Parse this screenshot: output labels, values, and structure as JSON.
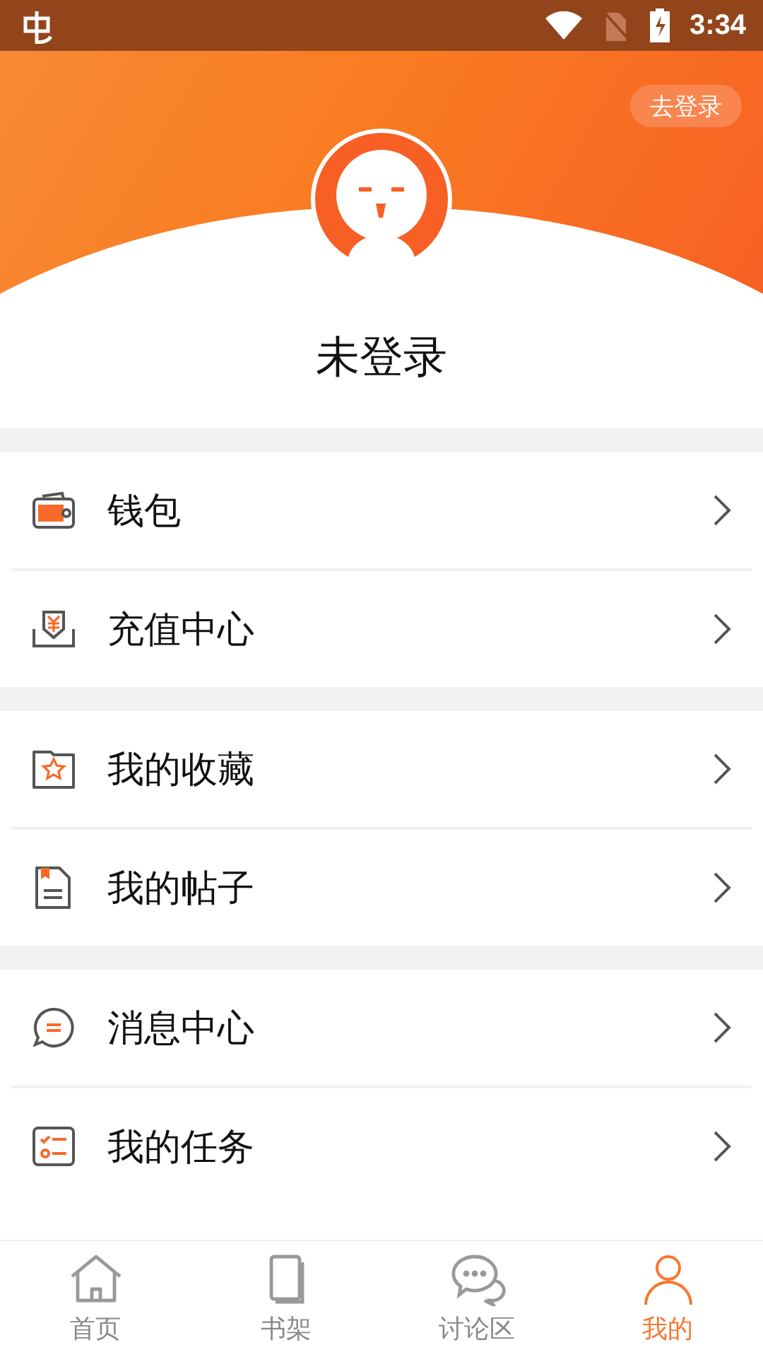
{
  "status_bar": {
    "time": "3:34"
  },
  "header": {
    "login_button": "去登录",
    "user_name": "未登录"
  },
  "groups": [
    {
      "items": [
        {
          "label": "钱包",
          "kind": "wallet"
        },
        {
          "label": "充值中心",
          "kind": "recharge"
        }
      ]
    },
    {
      "items": [
        {
          "label": "我的收藏",
          "kind": "favorites"
        },
        {
          "label": "我的帖子",
          "kind": "posts"
        }
      ]
    },
    {
      "items": [
        {
          "label": "消息中心",
          "kind": "messages"
        },
        {
          "label": "我的任务",
          "kind": "tasks"
        }
      ]
    }
  ],
  "tab_bar": [
    {
      "label": "首页",
      "kind": "home",
      "selected": false
    },
    {
      "label": "书架",
      "kind": "shelf",
      "selected": false
    },
    {
      "label": "讨论区",
      "kind": "discuss",
      "selected": false
    },
    {
      "label": "我的",
      "kind": "profile",
      "selected": true
    }
  ]
}
